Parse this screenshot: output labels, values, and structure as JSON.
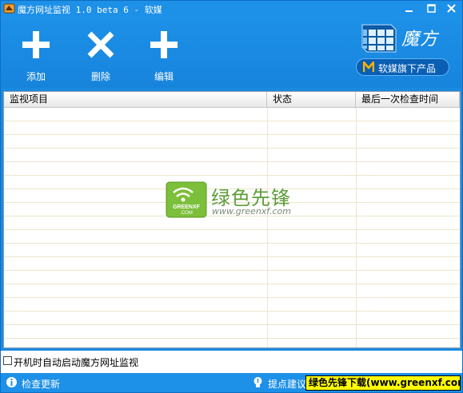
{
  "window": {
    "title": "魔方网址监视 1.0 beta 6 - 软媒",
    "accent": "#1d90e8"
  },
  "window_controls": [
    {
      "icon": "minimize-icon"
    },
    {
      "icon": "maximize-icon"
    },
    {
      "icon": "close-icon"
    }
  ],
  "toolbar": {
    "add_label": "添加",
    "delete_label": "删除",
    "edit_label": "编辑"
  },
  "brand": {
    "name": "魔方",
    "pill_text": "软媒旗下产品"
  },
  "table": {
    "columns": [
      "监视项目",
      "状态",
      "最后一次检查时间"
    ],
    "rows": []
  },
  "watermark": {
    "cn": "绿色先锋",
    "url": "www.greenxf.com",
    "logo_text": "GREENXF .COM"
  },
  "options": {
    "autostart_label": "开机时自动启动魔方网址监视",
    "autostart_checked": false
  },
  "statusbar": {
    "check_update": "检查更新",
    "suggest": "提点建议",
    "banner": "绿色先锋下载(www.greenxf.com)"
  }
}
